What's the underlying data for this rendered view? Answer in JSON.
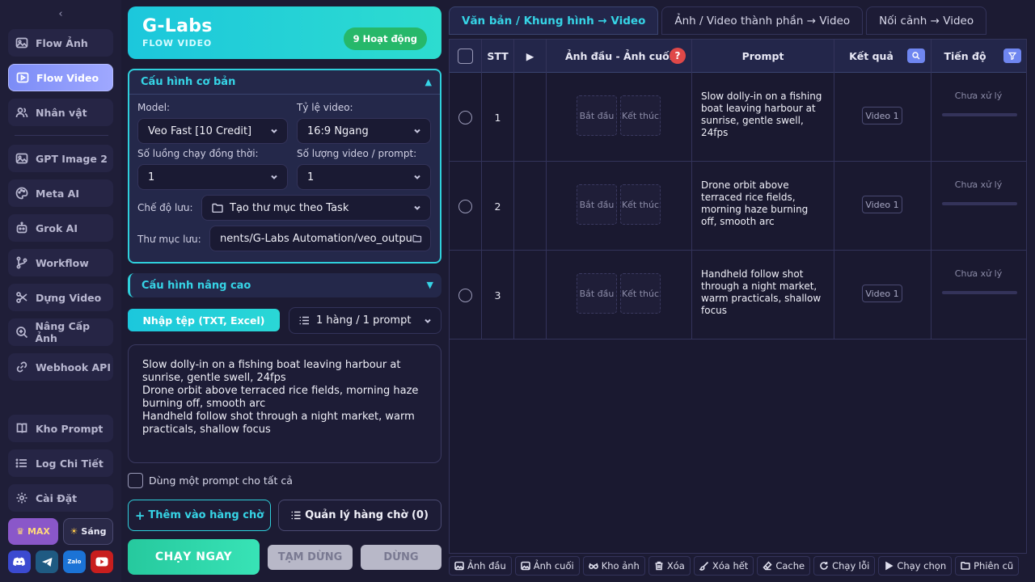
{
  "sidebar": {
    "items": [
      {
        "label": "Flow Ảnh",
        "icon": "image-icon"
      },
      {
        "label": "Flow Video",
        "icon": "play-square-icon"
      },
      {
        "label": "Nhân vật",
        "icon": "users-icon"
      },
      {
        "label": "GPT Image 2",
        "icon": "image-icon"
      },
      {
        "label": "Meta AI",
        "icon": "palette-icon"
      },
      {
        "label": "Grok AI",
        "icon": "bot-icon"
      },
      {
        "label": "Workflow",
        "icon": "branch-icon"
      },
      {
        "label": "Dựng Video",
        "icon": "scissors-icon"
      },
      {
        "label": "Nâng Cấp Ảnh",
        "icon": "zoom-in-icon"
      },
      {
        "label": "Webhook API",
        "icon": "link-icon"
      },
      {
        "label": "Kho Prompt",
        "icon": "book-icon"
      },
      {
        "label": "Log Chi Tiết",
        "icon": "list-icon"
      },
      {
        "label": "Cài Đặt",
        "icon": "gear-icon"
      }
    ],
    "max_label": "MAX",
    "theme_label": "Sáng"
  },
  "brand": {
    "title": "G-Labs",
    "subtitle": "FLOW VIDEO",
    "active_badge": "9 Hoạt động"
  },
  "basic_config": {
    "title": "Cấu hình cơ bản",
    "model_label": "Model:",
    "model_value": "Veo Fast [10 Credit]",
    "ratio_label": "Tỷ lệ video:",
    "ratio_value": "16:9 Ngang",
    "threads_label": "Số luồng chạy đồng thời:",
    "threads_value": "1",
    "count_label": "Số lượng video / prompt:",
    "count_value": "1",
    "save_mode_label": "Chế độ lưu:",
    "save_mode_value": "Tạo thư mục theo Task",
    "folder_label": "Thư mục lưu:",
    "folder_value": "nents/G-Labs Automation/veo_output"
  },
  "advanced_config": {
    "title": "Cấu hình nâng cao"
  },
  "import": {
    "button": "Nhập tệp (TXT, Excel)",
    "mode_value": "1 hàng / 1 prompt"
  },
  "prompts_text": [
    "Slow dolly-in on a fishing boat leaving harbour at sunrise, gentle swell, 24fps",
    "Drone orbit above terraced rice fields, morning haze burning off, smooth arc",
    "Handheld follow shot through a night market, warm practicals, shallow focus"
  ],
  "single_prompt_label": "Dùng một prompt cho tất cả",
  "actions": {
    "add_queue": "Thêm vào hàng chờ",
    "manage_queue": "Quản lý hàng chờ (0)",
    "run_now": "CHẠY NGAY",
    "pause": "TẠM DỪNG",
    "stop": "DỪNG"
  },
  "tabs": [
    "Văn bản / Khung hình → Video",
    "Ảnh / Video thành phần → Video",
    "Nối cảnh → Video"
  ],
  "table": {
    "headers": {
      "stt": "STT",
      "play": "▶",
      "frames": "Ảnh đầu - Ảnh cuối",
      "prompt": "Prompt",
      "result": "Kết quả",
      "progress": "Tiến độ"
    },
    "rows": [
      {
        "stt": "1",
        "start": "Bắt đầu",
        "end": "Kết thúc",
        "prompt": "Slow dolly-in on a fishing boat leaving harbour at sunrise, gentle swell, 24fps",
        "result": "Video 1",
        "status": "Chưa xử lý",
        "progress": 0
      },
      {
        "stt": "2",
        "start": "Bắt đầu",
        "end": "Kết thúc",
        "prompt": "Drone orbit above terraced rice fields, morning haze burning off, smooth arc",
        "result": "Video 1",
        "status": "Chưa xử lý",
        "progress": 0
      },
      {
        "stt": "3",
        "start": "Bắt đầu",
        "end": "Kết thúc",
        "prompt": "Handheld follow shot through a night market, warm practicals, shallow focus",
        "result": "Video 1",
        "status": "Chưa xử lý",
        "progress": 0
      }
    ]
  },
  "footer": [
    "Ảnh đầu",
    "Ảnh cuối",
    "Kho ảnh",
    "Xóa",
    "Xóa hết",
    "Cache",
    "Chạy lỗi",
    "Chạy chọn",
    "Phiên cũ"
  ],
  "colors": {
    "accent": "#2fd0dc",
    "success": "#26b86a",
    "danger": "#e04848",
    "sidebar_active": "#8c98fa"
  }
}
